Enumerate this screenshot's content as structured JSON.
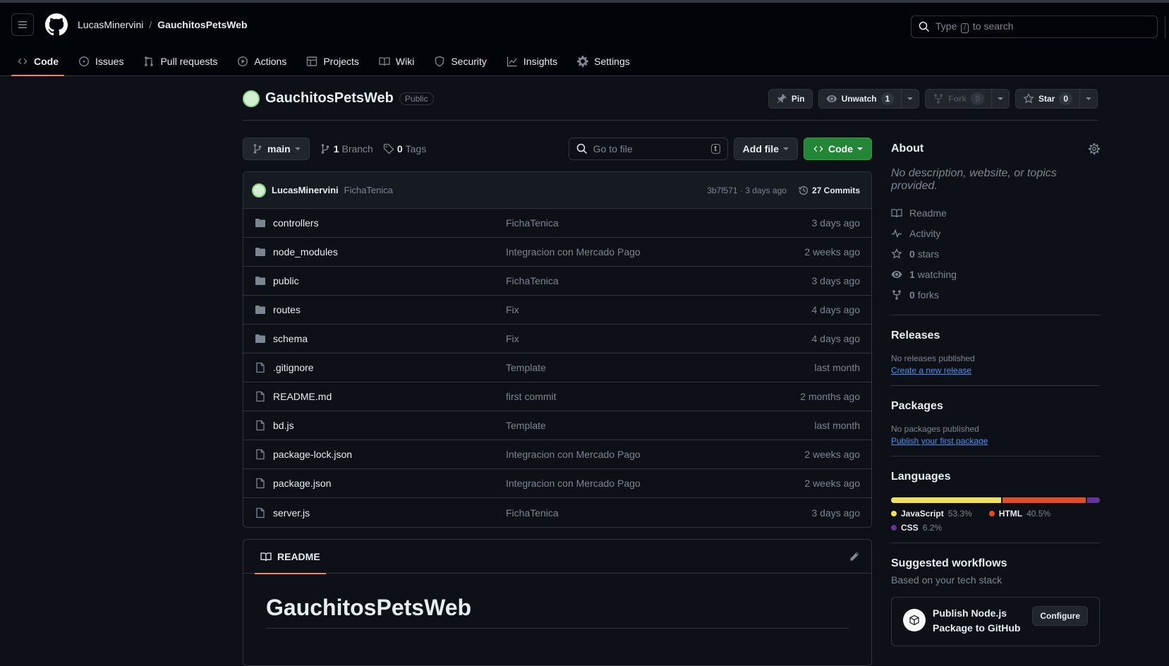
{
  "header": {
    "owner": "LucasMinervini",
    "separator": "/",
    "repo": "GauchitosPetsWeb",
    "search_prefix": "Type",
    "search_key": "/",
    "search_suffix": "to search"
  },
  "nav": {
    "tabs": [
      {
        "label": "Code",
        "icon": "code-icon",
        "active": true
      },
      {
        "label": "Issues",
        "icon": "issue-icon"
      },
      {
        "label": "Pull requests",
        "icon": "pull-request-icon"
      },
      {
        "label": "Actions",
        "icon": "play-icon"
      },
      {
        "label": "Projects",
        "icon": "table-icon"
      },
      {
        "label": "Wiki",
        "icon": "book-icon"
      },
      {
        "label": "Security",
        "icon": "shield-icon"
      },
      {
        "label": "Insights",
        "icon": "graph-icon"
      },
      {
        "label": "Settings",
        "icon": "gear-icon"
      }
    ]
  },
  "repo": {
    "name": "GauchitosPetsWeb",
    "visibility": "Public",
    "pin_label": "Pin",
    "unwatch_label": "Unwatch",
    "watch_count": "1",
    "fork_label": "Fork",
    "fork_count": "0",
    "star_label": "Star",
    "star_count": "0"
  },
  "toolbar": {
    "branch": "main",
    "branch_count": "1",
    "branch_word": "Branch",
    "tag_count": "0",
    "tag_word": "Tags",
    "goto_placeholder": "Go to file",
    "goto_key": "t",
    "add_file": "Add file",
    "code": "Code"
  },
  "commit": {
    "author": "LucasMinervini",
    "message": "FichaTenica",
    "sha_date": "3b7f571 · 3 days ago",
    "commits": "27 Commits"
  },
  "files": [
    {
      "name": "controllers",
      "type": "dir",
      "msg": "FichaTenica",
      "date": "3 days ago"
    },
    {
      "name": "node_modules",
      "type": "dir",
      "msg": "Integracion con Mercado Pago",
      "date": "2 weeks ago"
    },
    {
      "name": "public",
      "type": "dir",
      "msg": "FichaTenica",
      "date": "3 days ago"
    },
    {
      "name": "routes",
      "type": "dir",
      "msg": "Fix",
      "date": "4 days ago"
    },
    {
      "name": "schema",
      "type": "dir",
      "msg": "Fix",
      "date": "4 days ago"
    },
    {
      "name": ".gitignore",
      "type": "file",
      "msg": "Template",
      "date": "last month"
    },
    {
      "name": "README.md",
      "type": "file",
      "msg": "first commit",
      "date": "2 months ago"
    },
    {
      "name": "bd.js",
      "type": "file",
      "msg": "Template",
      "date": "last month"
    },
    {
      "name": "package-lock.json",
      "type": "file",
      "msg": "Integracion con Mercado Pago",
      "date": "2 weeks ago"
    },
    {
      "name": "package.json",
      "type": "file",
      "msg": "Integracion con Mercado Pago",
      "date": "2 weeks ago"
    },
    {
      "name": "server.js",
      "type": "file",
      "msg": "FichaTenica",
      "date": "3 days ago"
    }
  ],
  "readme": {
    "tab": "README",
    "heading": "GauchitosPetsWeb"
  },
  "about": {
    "title": "About",
    "description": "No description, website, or topics provided.",
    "items": [
      {
        "icon": "book-icon",
        "label": "Readme"
      },
      {
        "icon": "pulse-icon",
        "label": "Activity"
      },
      {
        "icon": "star-icon",
        "count": "0",
        "label": "stars"
      },
      {
        "icon": "eye-icon",
        "count": "1",
        "label": "watching"
      },
      {
        "icon": "fork-icon",
        "count": "0",
        "label": "forks"
      }
    ]
  },
  "releases": {
    "title": "Releases",
    "empty": "No releases published",
    "link": "Create a new release"
  },
  "packages": {
    "title": "Packages",
    "empty": "No packages published",
    "link": "Publish your first package"
  },
  "languages": {
    "title": "Languages",
    "items": [
      {
        "name": "JavaScript",
        "pct": "53.3%",
        "value": 53.3,
        "color": "#f1e05a"
      },
      {
        "name": "HTML",
        "pct": "40.5%",
        "value": 40.5,
        "color": "#e34c26"
      },
      {
        "name": "CSS",
        "pct": "6.2%",
        "value": 6.2,
        "color": "#663399"
      }
    ]
  },
  "workflows": {
    "title": "Suggested workflows",
    "subtitle": "Based on your tech stack",
    "card_title_1": "Publish Node.js",
    "card_title_2": "Package to GitHub",
    "configure": "Configure"
  }
}
